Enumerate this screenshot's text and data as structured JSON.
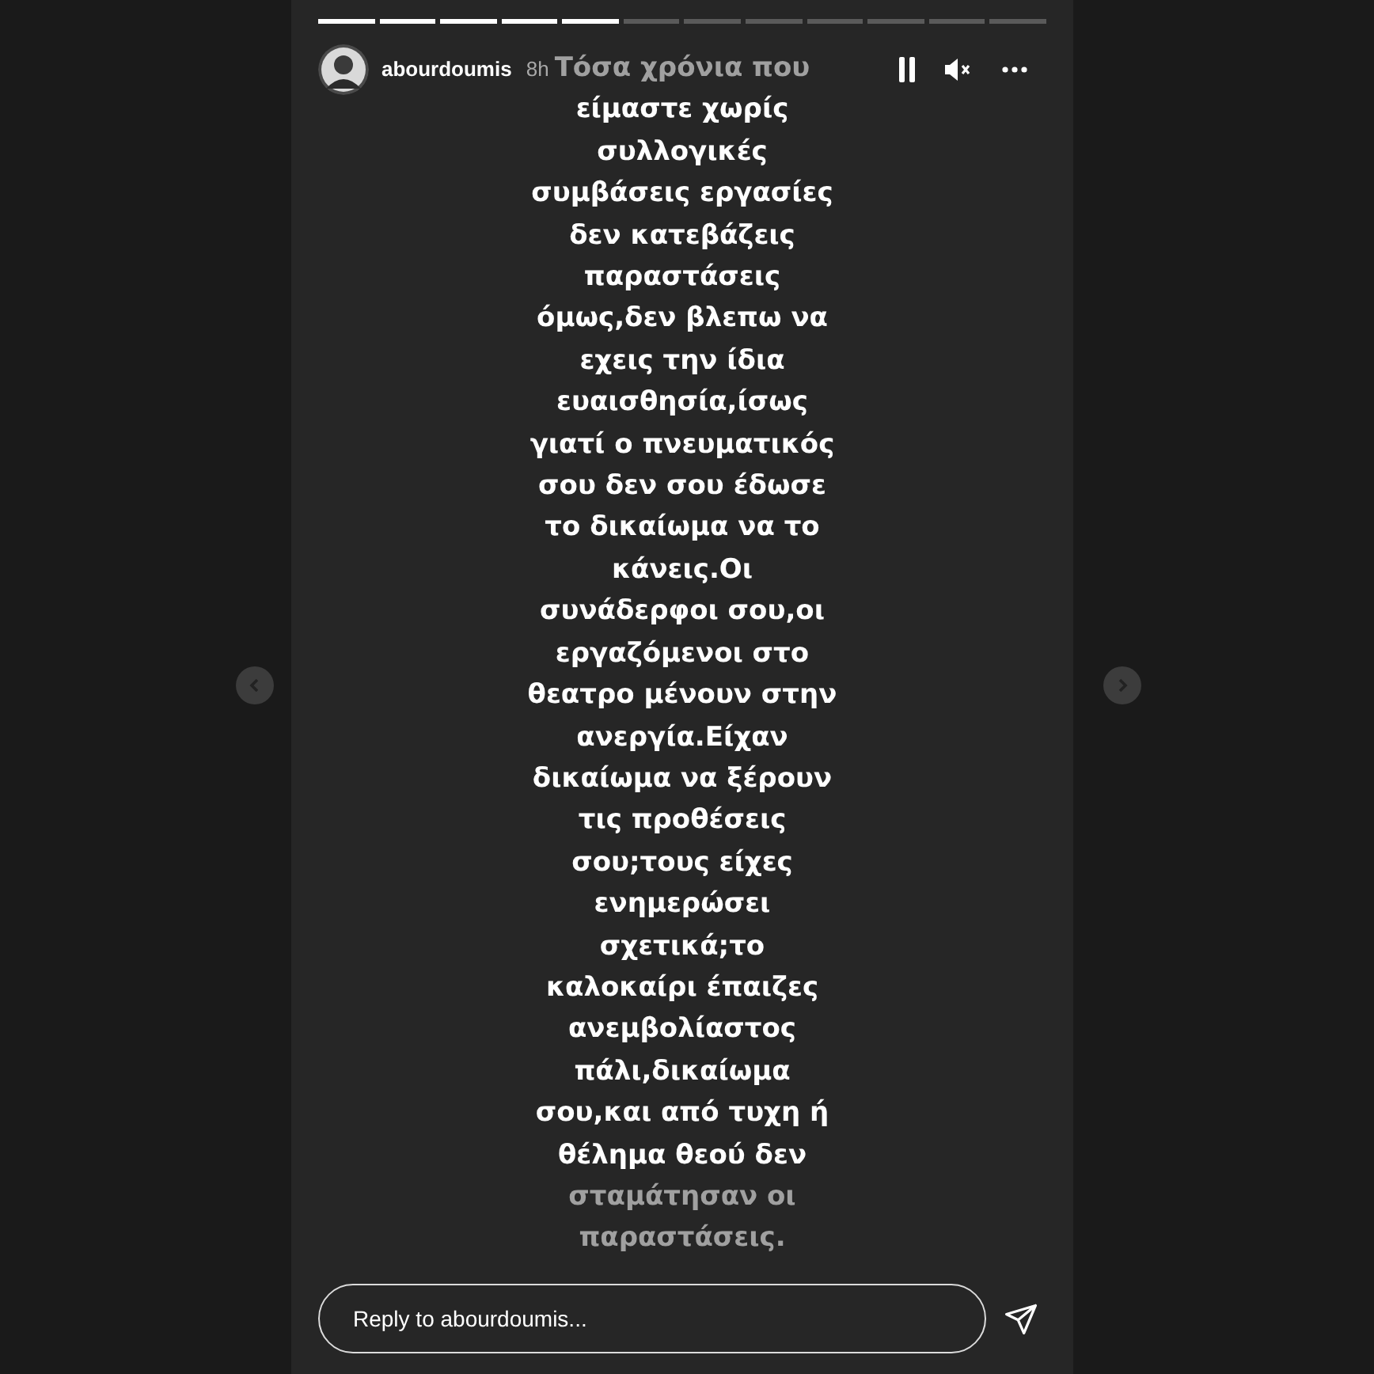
{
  "progress": [
    {
      "seen": true
    },
    {
      "seen": true
    },
    {
      "seen": true
    },
    {
      "seen": true
    },
    {
      "seen": true
    },
    {
      "seen": false
    },
    {
      "seen": false
    },
    {
      "seen": false
    },
    {
      "seen": false
    },
    {
      "seen": false
    },
    {
      "seen": false
    },
    {
      "seen": false
    }
  ],
  "header": {
    "username": "abourdoumis",
    "time": "8h"
  },
  "controls": {
    "paused": false,
    "muted": true
  },
  "story_lines": [
    {
      "text": "Τόσα χρόνια που",
      "dimmed": true
    },
    {
      "text": "είμαστε χωρίς",
      "dimmed": false
    },
    {
      "text": "συλλογικές",
      "dimmed": false
    },
    {
      "text": "συμβάσεις εργασίες",
      "dimmed": false
    },
    {
      "text": "δεν κατεβάζεις",
      "dimmed": false
    },
    {
      "text": "παραστάσεις",
      "dimmed": false
    },
    {
      "text": "όμως,δεν βλεπω να",
      "dimmed": false
    },
    {
      "text": "εχεις την ίδια",
      "dimmed": false
    },
    {
      "text": "ευαισθησία,ίσως",
      "dimmed": false
    },
    {
      "text": "γιατί ο πνευματικός",
      "dimmed": false
    },
    {
      "text": "σου δεν σου έδωσε",
      "dimmed": false
    },
    {
      "text": "το δικαίωμα να το",
      "dimmed": false
    },
    {
      "text": "κάνεις.Οι",
      "dimmed": false
    },
    {
      "text": "συνάδερφοι σου,οι",
      "dimmed": false
    },
    {
      "text": "εργαζόμενοι στο",
      "dimmed": false
    },
    {
      "text": "θεατρο μένουν στην",
      "dimmed": false
    },
    {
      "text": "ανεργία.Είχαν",
      "dimmed": false
    },
    {
      "text": "δικαίωμα να ξέρουν",
      "dimmed": false
    },
    {
      "text": "τις προθέσεις",
      "dimmed": false
    },
    {
      "text": "σου;τους είχες",
      "dimmed": false
    },
    {
      "text": "ενημερώσει",
      "dimmed": false
    },
    {
      "text": "σχετικά;το",
      "dimmed": false
    },
    {
      "text": "καλοκαίρι έπαιζες",
      "dimmed": false
    },
    {
      "text": "ανεμβολίαστος",
      "dimmed": false
    },
    {
      "text": "πάλι,δικαίωμα",
      "dimmed": false
    },
    {
      "text": "σου,και από τυχη ή",
      "dimmed": false
    },
    {
      "text": "θέλημα θεού δεν",
      "dimmed": false
    },
    {
      "text": "σταμάτησαν οι",
      "dimmed": true
    },
    {
      "text": "παραστάσεις.",
      "dimmed": true
    }
  ],
  "reply": {
    "placeholder": "Reply to abourdoumis..."
  }
}
